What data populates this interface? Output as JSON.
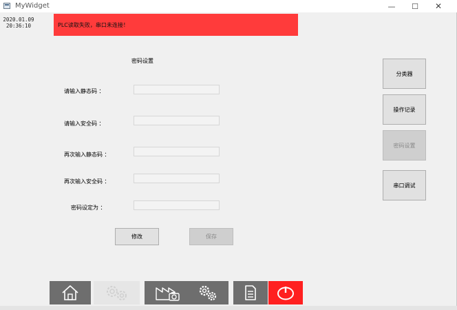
{
  "window": {
    "title": "MyWidget",
    "minimize_glyph": "—",
    "maximize_glyph": "☐",
    "close_glyph": "✕"
  },
  "status": {
    "date": "2020.01.09",
    "time": "20:36:10",
    "alarm_text": "PLC读取失败，串口未连接！"
  },
  "form": {
    "title": "密码设置",
    "fields": [
      {
        "label": "请输入静态码 ：",
        "value": ""
      },
      {
        "label": "请输入安全码 ：",
        "value": ""
      },
      {
        "label": "再次输入静态码 ：",
        "value": ""
      },
      {
        "label": "再次输入安全码 ：",
        "value": ""
      },
      {
        "label": "密码设定为 ：",
        "value": ""
      }
    ],
    "modify_label": "修改",
    "save_label": "保存"
  },
  "sidebar": {
    "items": [
      {
        "label": "分类器"
      },
      {
        "label": "操作记录"
      },
      {
        "label": "密码设置"
      },
      {
        "label": "串口调试"
      }
    ]
  },
  "toolbar": {
    "icons": [
      "home-icon",
      "gears-icon",
      "factory-camera-icon",
      "gears-icon",
      "document-icon",
      "power-icon"
    ],
    "colors": {
      "dark": "#6e6e6e",
      "faded": "#e6e6e6",
      "power": "#ff2020"
    }
  },
  "colors": {
    "alarm_bg": "#ff3b3b",
    "window_bg": "#f0f0f0"
  }
}
